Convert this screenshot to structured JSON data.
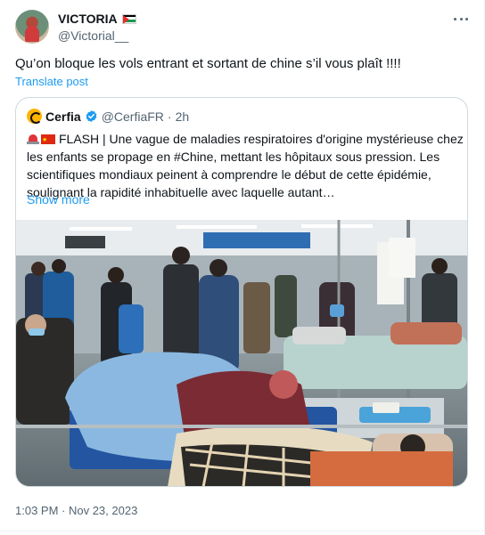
{
  "author": {
    "display_name": "VICTORIA",
    "flag_icon": "palestine-flag-icon",
    "handle": "@Victorial__",
    "avatar_icon": "user-avatar"
  },
  "tweet": {
    "text": "Qu’on bloque les vols entrant et sortant de chine s’il vous plaît !!!!",
    "translate_label": "Translate post",
    "timestamp": "1:03 PM · Nov 23, 2023",
    "more_icon": "more-options-icon"
  },
  "quote": {
    "name": "Cerfia",
    "verified_color": "#1d9bf0",
    "handle": "@CerfiaFR",
    "separator": "·",
    "age": "2h",
    "lines": [
      "FLASH | Une vague de maladies respiratoires d'origine mystérieuse chez",
      "les enfants se propage en #Chine, mettant les hôpitaux sous pression. Les",
      "scientifiques mondiaux peinent à comprendre le début de cette épidémie,",
      "soulignant la rapidité inhabituelle avec laquelle autant…"
    ],
    "show_more_label": "Show more",
    "media_icon": "hospital-corridor-photo"
  },
  "colors": {
    "link": "#1d9bf0",
    "muted": "#536471",
    "border": "#cfd9de"
  }
}
